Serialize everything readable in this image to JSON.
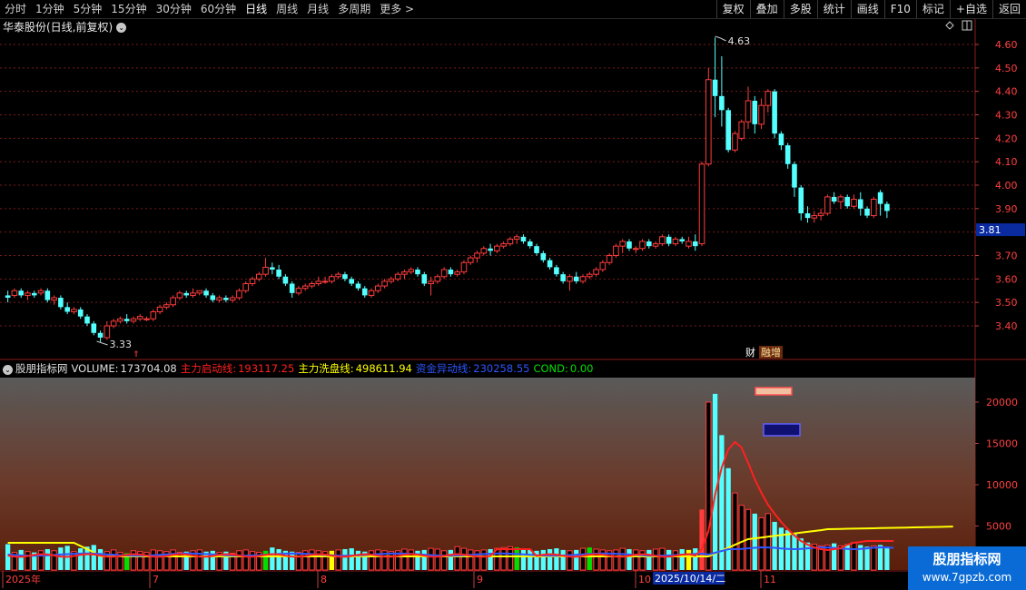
{
  "toolbar": {
    "periods": [
      "分时",
      "1分钟",
      "5分钟",
      "15分钟",
      "30分钟",
      "60分钟",
      "日线",
      "周线",
      "月线",
      "多周期",
      "更多 >"
    ],
    "active_period": "日线",
    "actions": [
      "复权",
      "叠加",
      "多股",
      "统计",
      "画线",
      "F10",
      "标记",
      "+自选",
      "返回"
    ]
  },
  "stock": {
    "title": "华泰股份(日线,前复权)"
  },
  "price_axis": {
    "labels": [
      "4.60",
      "4.50",
      "4.40",
      "4.30",
      "4.20",
      "4.10",
      "4.00",
      "3.90",
      "3.80",
      "3.70",
      "3.60",
      "3.50",
      "3.40"
    ],
    "current": "3.81"
  },
  "annotations": {
    "high": "4.63",
    "low": "3.33",
    "marker_a": "财",
    "marker_b": "融增"
  },
  "indicator": {
    "name": "股朋指标网",
    "volume_label": "VOLUME:",
    "volume_value": "173704.08",
    "line1_label": "主力启动线:",
    "line1_value": "193117.25",
    "line2_label": "主力洗盘线:",
    "line2_value": "498611.94",
    "line3_label": "资金异动线:",
    "line3_value": "230258.55",
    "cond_label": "COND:",
    "cond_value": "0.00"
  },
  "volume_axis": {
    "labels": [
      "20000",
      "15000",
      "10000",
      "5000"
    ]
  },
  "date_axis": {
    "labels": [
      "2025年",
      "7",
      "8",
      "9",
      "10",
      "11"
    ],
    "selected": "2025/10/14/二"
  },
  "colors": {
    "up": "#ff3c3c",
    "down": "#54ffff",
    "ma_yellow": "#ffff00",
    "ma_blue": "#2d56ff",
    "line_red": "#ff2020",
    "grid": "#7a1a1a",
    "highlight_green": "#00e000",
    "highlight_yellow": "#ffff00"
  },
  "watermark": {
    "title": "股朋指标网",
    "url": "www.7gpzb.com"
  },
  "chart_data": {
    "type": "candlestick",
    "title": "华泰股份(日线,前复权)",
    "ylim": [
      3.3,
      4.66
    ],
    "ohlc": [
      [
        3.53,
        3.55,
        3.5,
        3.52
      ],
      [
        3.53,
        3.56,
        3.52,
        3.55
      ],
      [
        3.55,
        3.56,
        3.52,
        3.53
      ],
      [
        3.53,
        3.55,
        3.51,
        3.54
      ],
      [
        3.54,
        3.55,
        3.52,
        3.53
      ],
      [
        3.54,
        3.56,
        3.53,
        3.55
      ],
      [
        3.55,
        3.56,
        3.5,
        3.51
      ],
      [
        3.51,
        3.53,
        3.49,
        3.52
      ],
      [
        3.52,
        3.53,
        3.47,
        3.48
      ],
      [
        3.48,
        3.5,
        3.45,
        3.46
      ],
      [
        3.46,
        3.48,
        3.45,
        3.47
      ],
      [
        3.47,
        3.48,
        3.43,
        3.44
      ],
      [
        3.44,
        3.45,
        3.4,
        3.41
      ],
      [
        3.41,
        3.42,
        3.36,
        3.37
      ],
      [
        3.37,
        3.38,
        3.33,
        3.35
      ],
      [
        3.35,
        3.42,
        3.34,
        3.4
      ],
      [
        3.4,
        3.43,
        3.39,
        3.42
      ],
      [
        3.42,
        3.44,
        3.41,
        3.43
      ],
      [
        3.43,
        3.45,
        3.41,
        3.42
      ],
      [
        3.42,
        3.44,
        3.41,
        3.43
      ],
      [
        3.43,
        3.45,
        3.42,
        3.44
      ],
      [
        3.43,
        3.44,
        3.42,
        3.43
      ],
      [
        3.43,
        3.47,
        3.42,
        3.46
      ],
      [
        3.46,
        3.49,
        3.45,
        3.48
      ],
      [
        3.48,
        3.5,
        3.47,
        3.49
      ],
      [
        3.49,
        3.53,
        3.48,
        3.52
      ],
      [
        3.52,
        3.55,
        3.51,
        3.54
      ],
      [
        3.54,
        3.55,
        3.52,
        3.53
      ],
      [
        3.53,
        3.56,
        3.52,
        3.54
      ],
      [
        3.54,
        3.55,
        3.53,
        3.55
      ],
      [
        3.55,
        3.56,
        3.52,
        3.53
      ],
      [
        3.53,
        3.54,
        3.5,
        3.51
      ],
      [
        3.51,
        3.53,
        3.5,
        3.52
      ],
      [
        3.52,
        3.53,
        3.5,
        3.51
      ],
      [
        3.51,
        3.53,
        3.5,
        3.52
      ],
      [
        3.52,
        3.56,
        3.51,
        3.55
      ],
      [
        3.55,
        3.59,
        3.54,
        3.58
      ],
      [
        3.58,
        3.61,
        3.57,
        3.6
      ],
      [
        3.6,
        3.63,
        3.59,
        3.62
      ],
      [
        3.62,
        3.69,
        3.61,
        3.65
      ],
      [
        3.65,
        3.67,
        3.62,
        3.64
      ],
      [
        3.64,
        3.66,
        3.6,
        3.61
      ],
      [
        3.61,
        3.62,
        3.57,
        3.58
      ],
      [
        3.58,
        3.59,
        3.52,
        3.54
      ],
      [
        3.54,
        3.57,
        3.53,
        3.56
      ],
      [
        3.56,
        3.58,
        3.55,
        3.57
      ],
      [
        3.57,
        3.59,
        3.56,
        3.58
      ],
      [
        3.58,
        3.61,
        3.57,
        3.59
      ],
      [
        3.59,
        3.61,
        3.58,
        3.59
      ],
      [
        3.59,
        3.62,
        3.58,
        3.61
      ],
      [
        3.61,
        3.63,
        3.6,
        3.62
      ],
      [
        3.62,
        3.63,
        3.59,
        3.6
      ],
      [
        3.6,
        3.61,
        3.57,
        3.58
      ],
      [
        3.58,
        3.59,
        3.55,
        3.56
      ],
      [
        3.56,
        3.57,
        3.52,
        3.53
      ],
      [
        3.53,
        3.56,
        3.52,
        3.55
      ],
      [
        3.55,
        3.58,
        3.54,
        3.57
      ],
      [
        3.57,
        3.6,
        3.56,
        3.59
      ],
      [
        3.59,
        3.61,
        3.58,
        3.6
      ],
      [
        3.6,
        3.63,
        3.59,
        3.62
      ],
      [
        3.62,
        3.64,
        3.6,
        3.63
      ],
      [
        3.63,
        3.65,
        3.62,
        3.64
      ],
      [
        3.64,
        3.65,
        3.61,
        3.62
      ],
      [
        3.62,
        3.63,
        3.57,
        3.58
      ],
      [
        3.58,
        3.61,
        3.53,
        3.59
      ],
      [
        3.59,
        3.62,
        3.58,
        3.61
      ],
      [
        3.61,
        3.65,
        3.6,
        3.64
      ],
      [
        3.64,
        3.65,
        3.61,
        3.62
      ],
      [
        3.62,
        3.64,
        3.61,
        3.63
      ],
      [
        3.63,
        3.68,
        3.62,
        3.67
      ],
      [
        3.67,
        3.7,
        3.66,
        3.69
      ],
      [
        3.69,
        3.72,
        3.67,
        3.71
      ],
      [
        3.71,
        3.74,
        3.7,
        3.73
      ],
      [
        3.73,
        3.75,
        3.7,
        3.72
      ],
      [
        3.72,
        3.75,
        3.71,
        3.74
      ],
      [
        3.74,
        3.76,
        3.73,
        3.75
      ],
      [
        3.75,
        3.78,
        3.74,
        3.77
      ],
      [
        3.77,
        3.79,
        3.75,
        3.78
      ],
      [
        3.78,
        3.79,
        3.75,
        3.76
      ],
      [
        3.76,
        3.77,
        3.73,
        3.74
      ],
      [
        3.74,
        3.75,
        3.7,
        3.71
      ],
      [
        3.71,
        3.72,
        3.67,
        3.68
      ],
      [
        3.68,
        3.69,
        3.64,
        3.65
      ],
      [
        3.65,
        3.66,
        3.61,
        3.62
      ],
      [
        3.62,
        3.63,
        3.58,
        3.59
      ],
      [
        3.59,
        3.62,
        3.55,
        3.61
      ],
      [
        3.61,
        3.63,
        3.58,
        3.59
      ],
      [
        3.59,
        3.62,
        3.58,
        3.61
      ],
      [
        3.61,
        3.63,
        3.6,
        3.62
      ],
      [
        3.62,
        3.65,
        3.61,
        3.64
      ],
      [
        3.64,
        3.68,
        3.63,
        3.67
      ],
      [
        3.67,
        3.71,
        3.66,
        3.7
      ],
      [
        3.7,
        3.75,
        3.69,
        3.74
      ],
      [
        3.74,
        3.77,
        3.71,
        3.76
      ],
      [
        3.76,
        3.77,
        3.72,
        3.73
      ],
      [
        3.73,
        3.74,
        3.71,
        3.73
      ],
      [
        3.73,
        3.77,
        3.72,
        3.76
      ],
      [
        3.76,
        3.77,
        3.73,
        3.74
      ],
      [
        3.74,
        3.76,
        3.73,
        3.75
      ],
      [
        3.75,
        3.79,
        3.74,
        3.78
      ],
      [
        3.78,
        3.79,
        3.74,
        3.75
      ],
      [
        3.75,
        3.78,
        3.74,
        3.77
      ],
      [
        3.77,
        3.78,
        3.75,
        3.76
      ],
      [
        3.74,
        3.78,
        3.73,
        3.76
      ],
      [
        3.76,
        3.79,
        3.72,
        3.74
      ],
      [
        3.75,
        4.1,
        3.74,
        4.09
      ],
      [
        4.09,
        4.5,
        4.08,
        4.45
      ],
      [
        4.45,
        4.63,
        4.29,
        4.38
      ],
      [
        4.38,
        4.55,
        4.25,
        4.32
      ],
      [
        4.32,
        4.33,
        4.14,
        4.15
      ],
      [
        4.15,
        4.23,
        4.14,
        4.22
      ],
      [
        4.2,
        4.28,
        4.19,
        4.27
      ],
      [
        4.27,
        4.42,
        4.24,
        4.36
      ],
      [
        4.36,
        4.38,
        4.22,
        4.26
      ],
      [
        4.26,
        4.37,
        4.24,
        4.34
      ],
      [
        4.34,
        4.41,
        4.31,
        4.4
      ],
      [
        4.4,
        4.41,
        4.2,
        4.22
      ],
      [
        4.22,
        4.23,
        4.15,
        4.17
      ],
      [
        4.17,
        4.18,
        4.07,
        4.09
      ],
      [
        4.09,
        4.1,
        3.95,
        3.99
      ],
      [
        3.99,
        4.0,
        3.85,
        3.88
      ],
      [
        3.88,
        3.91,
        3.84,
        3.86
      ],
      [
        3.86,
        3.89,
        3.84,
        3.87
      ],
      [
        3.87,
        3.9,
        3.85,
        3.88
      ],
      [
        3.88,
        3.96,
        3.87,
        3.95
      ],
      [
        3.95,
        3.97,
        3.92,
        3.93
      ],
      [
        3.93,
        3.96,
        3.9,
        3.95
      ],
      [
        3.95,
        3.96,
        3.9,
        3.91
      ],
      [
        3.91,
        3.96,
        3.9,
        3.94
      ],
      [
        3.94,
        3.97,
        3.87,
        3.9
      ],
      [
        3.9,
        3.91,
        3.86,
        3.87
      ],
      [
        3.87,
        3.95,
        3.86,
        3.94
      ],
      [
        3.97,
        3.98,
        3.87,
        3.92
      ],
      [
        3.92,
        3.93,
        3.86,
        3.89
      ]
    ],
    "volume": [
      2800,
      1800,
      2100,
      1900,
      1800,
      2000,
      2200,
      2000,
      2400,
      2600,
      1900,
      2300,
      2500,
      2700,
      2200,
      1900,
      2100,
      1800,
      1700,
      2000,
      1900,
      1800,
      2100,
      2000,
      1900,
      2100,
      1800,
      1900,
      2000,
      2100,
      1900,
      2000,
      1800,
      1900,
      1700,
      2000,
      2100,
      1900,
      1800,
      2000,
      2400,
      2200,
      2000,
      1900,
      1800,
      2000,
      2100,
      2000,
      1900,
      2000,
      2100,
      2200,
      2300,
      2000,
      1900,
      2000,
      2100,
      2000,
      1900,
      2000,
      2200,
      2100,
      2000,
      2100,
      2300,
      2200,
      2000,
      2100,
      2500,
      2300,
      2100,
      2000,
      2100,
      2200,
      2300,
      2400,
      2500,
      2400,
      2200,
      2100,
      2000,
      2100,
      2200,
      2300,
      2100,
      2000,
      2100,
      2300,
      2400,
      2200,
      2100,
      2000,
      2100,
      2300,
      2200,
      2100,
      2000,
      2100,
      2200,
      2300,
      2100,
      2000,
      2200,
      2100,
      2300,
      7000,
      20000,
      21000,
      16000,
      12000,
      9000,
      7500,
      7000,
      6500,
      6000,
      6500,
      5500,
      4800,
      4500,
      4000,
      3500,
      3000,
      2800,
      2600,
      2700,
      2900,
      2600,
      2800,
      3000,
      2700,
      2500,
      2600,
      2700,
      2500
    ],
    "highlight_green": [
      18,
      39,
      77,
      88
    ],
    "highlight_yellow": [
      49,
      103
    ],
    "xlabels": [
      "2025年",
      "7",
      "8",
      "9",
      "10",
      "11"
    ],
    "selected_date": "2025/10/14/二",
    "series": [
      {
        "name": "主力启动线",
        "last_value": 193117.25
      },
      {
        "name": "主力洗盘线",
        "last_value": 498611.94
      },
      {
        "name": "资金异动线",
        "last_value": 230258.55
      },
      {
        "name": "COND",
        "last_value": 0.0
      }
    ]
  }
}
